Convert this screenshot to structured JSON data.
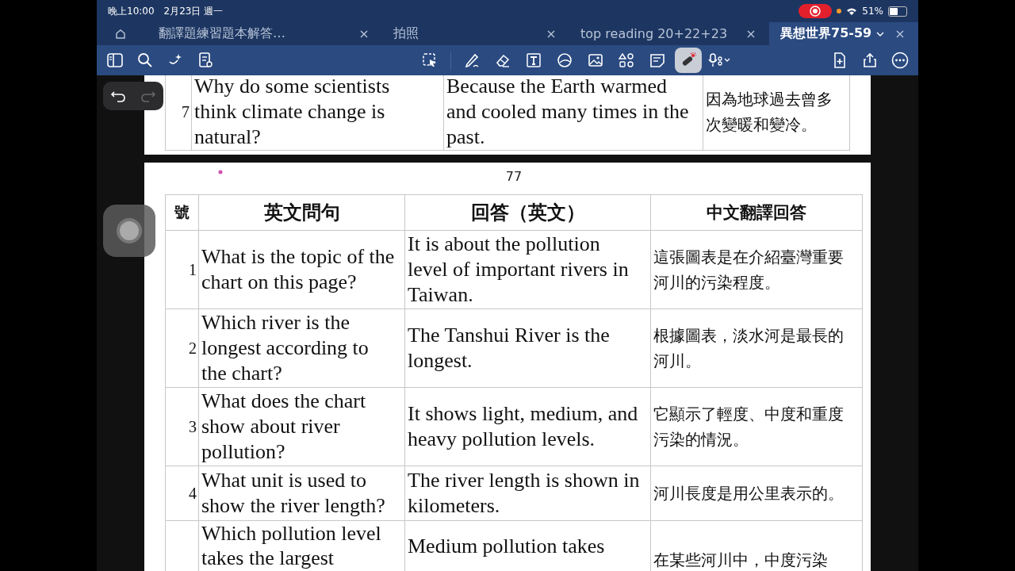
{
  "status_bar": {
    "time": "晚上10:00",
    "date": "2月23日 週一",
    "recording": true,
    "battery": "51%"
  },
  "tabs": [
    {
      "kind": "home",
      "selected": false
    },
    {
      "kind": "doc",
      "label": "翻譯題練習題本解答…",
      "selected": false
    },
    {
      "kind": "doc",
      "label": "拍照",
      "selected": false
    },
    {
      "kind": "doc",
      "label": "top reading 20+22+23",
      "selected": false
    },
    {
      "kind": "doc",
      "label": "異想世界75-59",
      "selected": true
    }
  ],
  "toolbar": {
    "left": [
      {
        "kind": "sidebar",
        "selected": false
      },
      {
        "kind": "search",
        "selected": false
      },
      {
        "kind": "sparkle",
        "selected": false
      },
      {
        "kind": "outline",
        "selected": false
      }
    ],
    "tools": [
      {
        "kind": "lasso",
        "selected": false
      },
      {
        "kind": "pen",
        "selected": false
      },
      {
        "kind": "eraser",
        "selected": false
      },
      {
        "kind": "text",
        "selected": false
      },
      {
        "kind": "shapes",
        "selected": false
      },
      {
        "kind": "image",
        "selected": false
      },
      {
        "kind": "elements",
        "selected": false
      },
      {
        "kind": "sticky",
        "selected": false
      },
      {
        "kind": "laser",
        "selected": true
      },
      {
        "kind": "mic",
        "selected": false
      }
    ],
    "right": [
      {
        "kind": "addpage",
        "selected": false
      },
      {
        "kind": "share",
        "selected": false
      },
      {
        "kind": "more",
        "selected": false
      }
    ]
  },
  "pages": [
    {
      "rows": [
        {
          "no": "7",
          "question": "Why do some scientists think climate change is natural?",
          "answer": "Because the Earth warmed and cooled many times in the past.",
          "chinese": "因為地球過去曾多次變暖和變冷。"
        }
      ]
    },
    {
      "page_number": "77",
      "columns": [
        "號",
        "英文問句",
        "回答（英文）",
        "中文翻譯回答"
      ],
      "rows": [
        {
          "no": "1",
          "question": "What is the topic of the chart on this page?",
          "answer": "It is about the pollution level of important rivers in Taiwan.",
          "chinese": "這張圖表是在介紹臺灣重要河川的污染程度。"
        },
        {
          "no": "2",
          "question": "Which river is the longest according to the chart?",
          "answer": "The Tanshui River is the longest.",
          "chinese": "根據圖表，淡水河是最長的河川。"
        },
        {
          "no": "3",
          "question": "What does the chart show about river pollution?",
          "answer": "It shows light, medium, and heavy pollution levels.",
          "chinese": "它顯示了輕度、中度和重度污染的情況。"
        },
        {
          "no": "4",
          "question": "What unit is used to show the river length?",
          "answer": "The river length is shown in kilometers.",
          "chinese": "河川長度是用公里表示的。"
        },
        {
          "question": "Which pollution level takes the largest",
          "answer": "Medium pollution takes",
          "chinese": "在某些河川中，中度污染"
        }
      ]
    }
  ]
}
